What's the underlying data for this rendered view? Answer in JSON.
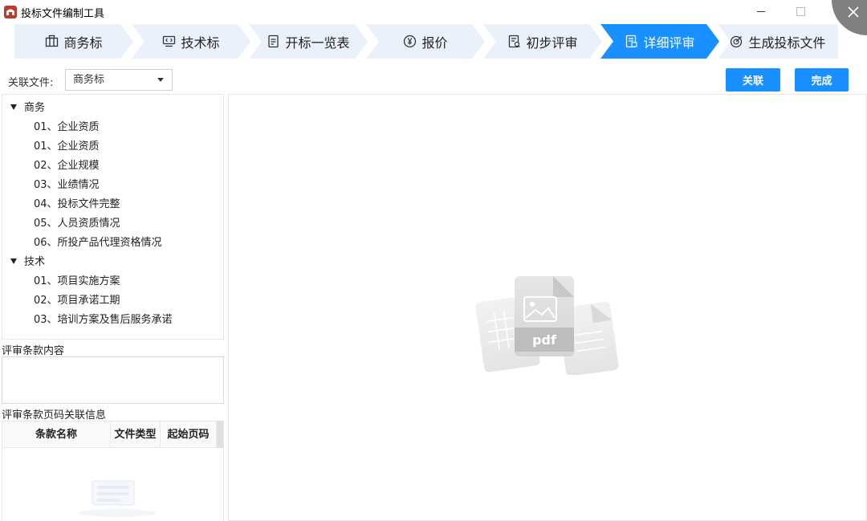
{
  "window": {
    "title": "投标文件编制工具"
  },
  "steps": [
    {
      "label": "商务标",
      "icon": "briefcase-icon",
      "active": false
    },
    {
      "label": "技术标",
      "icon": "code-monitor-icon",
      "active": false
    },
    {
      "label": "开标一览表",
      "icon": "document-list-icon",
      "active": false
    },
    {
      "label": "报价",
      "icon": "yen-icon",
      "active": false
    },
    {
      "label": "初步评审",
      "icon": "review-doc-icon",
      "active": false
    },
    {
      "label": "详细评审",
      "icon": "detail-review-icon",
      "active": true
    },
    {
      "label": "生成投标文件",
      "icon": "target-icon",
      "active": false
    }
  ],
  "association": {
    "label": "关联文件:",
    "selected": "商务标",
    "link_button": "关联",
    "done_button": "完成"
  },
  "tree": {
    "groups": [
      {
        "label": "商务",
        "items": [
          "01、企业资质",
          "01、企业资质",
          "02、企业规模",
          "03、业绩情况",
          "04、投标文件完整",
          "05、人员资质情况",
          "06、所投产品代理资格情况"
        ]
      },
      {
        "label": "技术",
        "items": [
          "01、项目实施方案",
          "02、项目承诺工期",
          "03、培训方案及售后服务承诺"
        ]
      }
    ]
  },
  "clause": {
    "content_label": "评审条款内容",
    "page_info_label": "评审条款页码关联信息",
    "columns": [
      "条款名称",
      "文件类型",
      "起始页码"
    ]
  },
  "preview": {
    "placeholder_text": "pdf"
  },
  "colors": {
    "accent": "#1890ff",
    "step_bg": "#eaf1fb"
  }
}
